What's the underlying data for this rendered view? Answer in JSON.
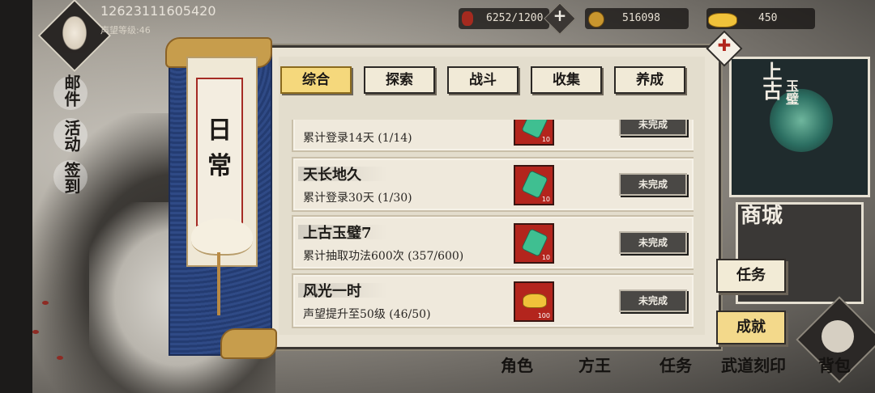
{
  "player": {
    "id": "12623111605420",
    "fame_level": "声望等级:46"
  },
  "resources": {
    "stamina": "6252/1200",
    "coins": "516098",
    "gold": "450"
  },
  "side_nav": {
    "mail": "邮件",
    "event": "活动",
    "signin": "签到"
  },
  "scroll": {
    "title": "日常"
  },
  "tabs": [
    {
      "label": "综合",
      "active": true
    },
    {
      "label": "探索",
      "active": false
    },
    {
      "label": "战斗",
      "active": false
    },
    {
      "label": "收集",
      "active": false
    },
    {
      "label": "养成",
      "active": false
    }
  ],
  "achievements": [
    {
      "title": "",
      "desc": "累计登录14天  (1/14)",
      "reward": "gem",
      "reward_qty": "10",
      "status": "未完成"
    },
    {
      "title": "天长地久",
      "desc": "累计登录30天  (1/30)",
      "reward": "gem",
      "reward_qty": "10",
      "status": "未完成"
    },
    {
      "title": "上古玉璧7",
      "desc": "累计抽取功法600次  (357/600)",
      "reward": "gem",
      "reward_qty": "10",
      "status": "未完成"
    },
    {
      "title": "风光一时",
      "desc": "声望提升至50级  (46/50)",
      "reward": "gold",
      "reward_qty": "100",
      "status": "未完成"
    }
  ],
  "right_panel": {
    "shop_label_1": "上古",
    "shop_label_2": "玉璧",
    "mall_label": "商城",
    "task_button": "任务",
    "achievement_button": "成就"
  },
  "bottom_nav": {
    "character": "角色",
    "fangwang": "方王",
    "tasks": "任务",
    "martial": "武道刻印",
    "bag": "背包"
  },
  "colors": {
    "accent_gold": "#f5d87c",
    "reward_red": "#b3251d",
    "gem_green": "#3fbf91"
  }
}
